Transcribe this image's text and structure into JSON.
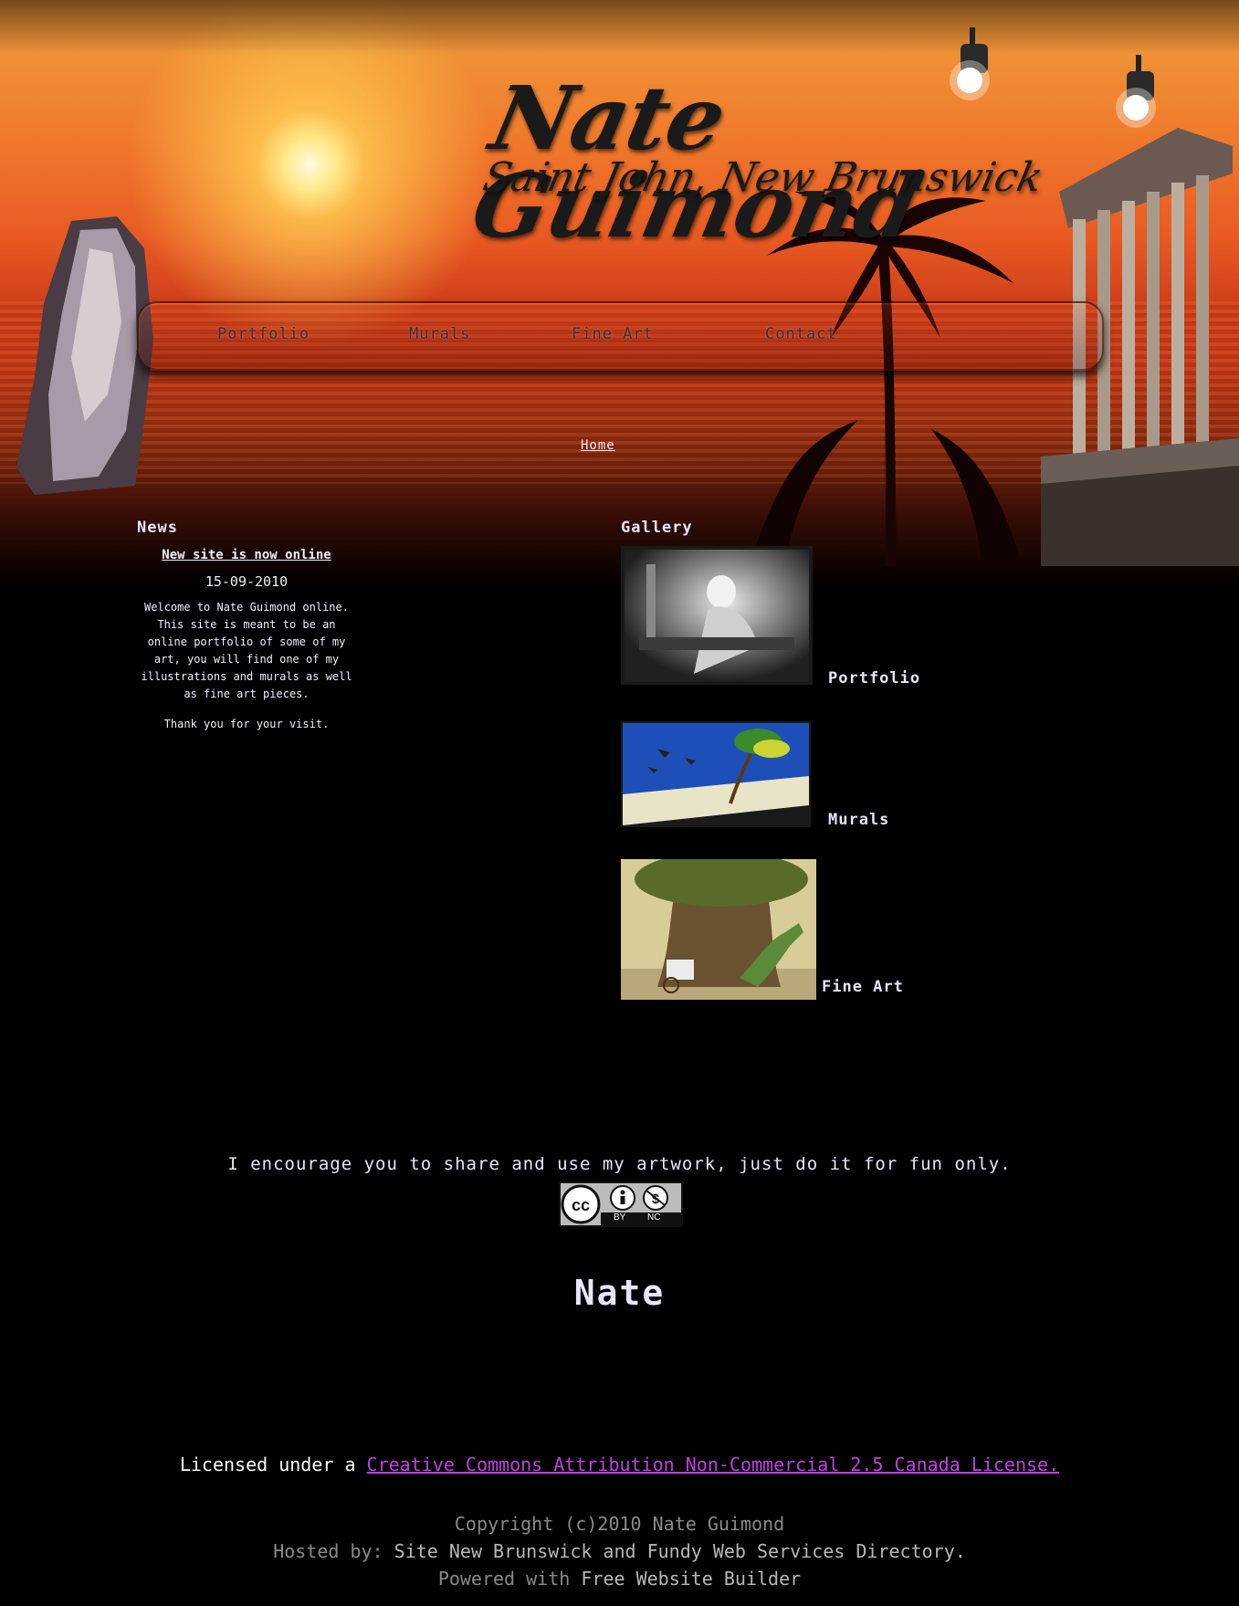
{
  "header": {
    "title": "Nate Guimond",
    "subtitle": "Saint John, New Brunswick"
  },
  "nav": {
    "items": [
      {
        "label": "Portfolio"
      },
      {
        "label": "Murals"
      },
      {
        "label": "Fine Art"
      },
      {
        "label": "Contact"
      }
    ]
  },
  "breadcrumb": "Home",
  "news": {
    "heading": "News",
    "title": "New site is now online",
    "date": "15-09-2010",
    "body": "Welcome to Nate Guimond online. This site is meant to be an online portfolio of some of my art, you will find one of my illustrations and murals as well as fine art pieces.",
    "thanks": "Thank you for your visit."
  },
  "gallery": {
    "heading": "Gallery",
    "items": [
      {
        "label": "Portfolio"
      },
      {
        "label": "Murals"
      },
      {
        "label": "Fine Art"
      }
    ]
  },
  "footer": {
    "remix_notice": "I encourage you to share and use my artwork, just do it for fun only.",
    "cc_labels": {
      "by": "BY",
      "nc": "NC"
    },
    "signature": "Nate",
    "license_lead": "Licensed under a",
    "license_link": "Creative Commons Attribution Non-Commercial 2.5 Canada License.",
    "copyright": "Copyright (c)2010 Nate Guimond",
    "hosted_prefix": "Hosted by:",
    "hosted_link": "Site New Brunswick and Fundy Web Services Directory.",
    "powered_prefix": "Powered with",
    "powered_link": "Free Website Builder"
  },
  "colors": {
    "background": "#000000",
    "text": "#e8e6ff",
    "license_link": "#c040e0",
    "footer_grey": "#8a8a8a"
  }
}
